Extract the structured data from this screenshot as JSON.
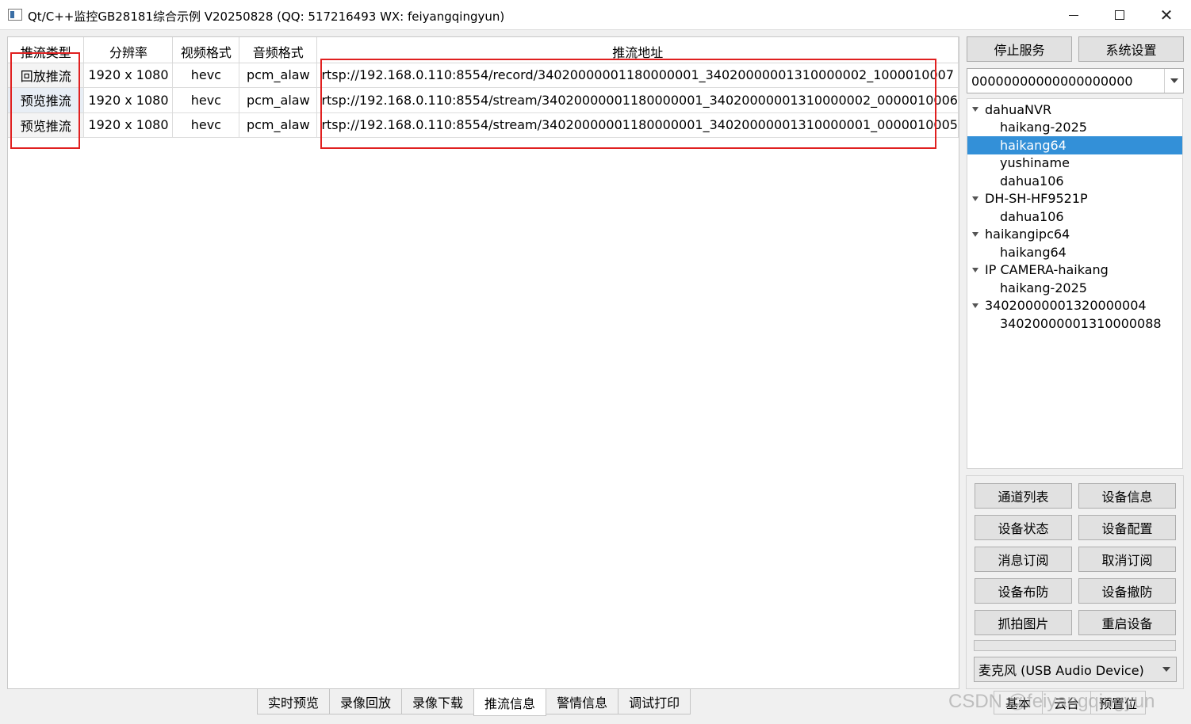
{
  "window": {
    "title": "Qt/C++监控GB28181综合示例 V20250828 (QQ: 517216493 WX: feiyangqingyun)"
  },
  "table": {
    "headers": [
      "推流类型",
      "分辨率",
      "视频格式",
      "音频格式",
      "推流地址"
    ],
    "rows": [
      {
        "type": "回放推流",
        "resolution": "1920 x 1080",
        "video": "hevc",
        "audio": "pcm_alaw",
        "url": "rtsp://192.168.0.110:8554/record/34020000001180000001_34020000001310000002_1000010007"
      },
      {
        "type": "预览推流",
        "resolution": "1920 x 1080",
        "video": "hevc",
        "audio": "pcm_alaw",
        "url": "rtsp://192.168.0.110:8554/stream/34020000001180000001_34020000001310000002_0000010006"
      },
      {
        "type": "预览推流",
        "resolution": "1920 x 1080",
        "video": "hevc",
        "audio": "pcm_alaw",
        "url": "rtsp://192.168.0.110:8554/stream/34020000001180000001_34020000001310000001_0000010005"
      }
    ]
  },
  "tabs": [
    "实时预览",
    "录像回放",
    "录像下载",
    "推流信息",
    "警情信息",
    "调试打印"
  ],
  "active_tab": "推流信息",
  "right_panel": {
    "stop_service": "停止服务",
    "system_settings": "系统设置",
    "device_combo": "00000000000000000000",
    "tree": [
      {
        "label": "dahuaNVR",
        "level": 0,
        "expanded": true
      },
      {
        "label": "haikang-2025",
        "level": 1
      },
      {
        "label": "haikang64",
        "level": 1,
        "selected": true
      },
      {
        "label": "yushiname",
        "level": 1
      },
      {
        "label": "dahua106",
        "level": 1
      },
      {
        "label": "DH-SH-HF9521P",
        "level": 0,
        "expanded": true
      },
      {
        "label": "dahua106",
        "level": 1
      },
      {
        "label": "haikangipc64",
        "level": 0,
        "expanded": true
      },
      {
        "label": "haikang64",
        "level": 1
      },
      {
        "label": "IP CAMERA-haikang",
        "level": 0,
        "expanded": true
      },
      {
        "label": "haikang-2025",
        "level": 1
      },
      {
        "label": "34020000001320000004",
        "level": 0,
        "expanded": true
      },
      {
        "label": "34020000001310000088",
        "level": 1
      }
    ],
    "action_buttons": [
      [
        "通道列表",
        "设备信息"
      ],
      [
        "设备状态",
        "设备配置"
      ],
      [
        "消息订阅",
        "取消订阅"
      ],
      [
        "设备布防",
        "设备撤防"
      ],
      [
        "抓拍图片",
        "重启设备"
      ]
    ],
    "audio_device": "麦克风 (USB Audio Device)",
    "bottom_buttons": [
      "基本",
      "云台",
      "预置位"
    ]
  },
  "watermark": "CSDN @feiyangqingyun",
  "colors": {
    "selection": "#3390d8",
    "annotation_box": "#e02020"
  }
}
